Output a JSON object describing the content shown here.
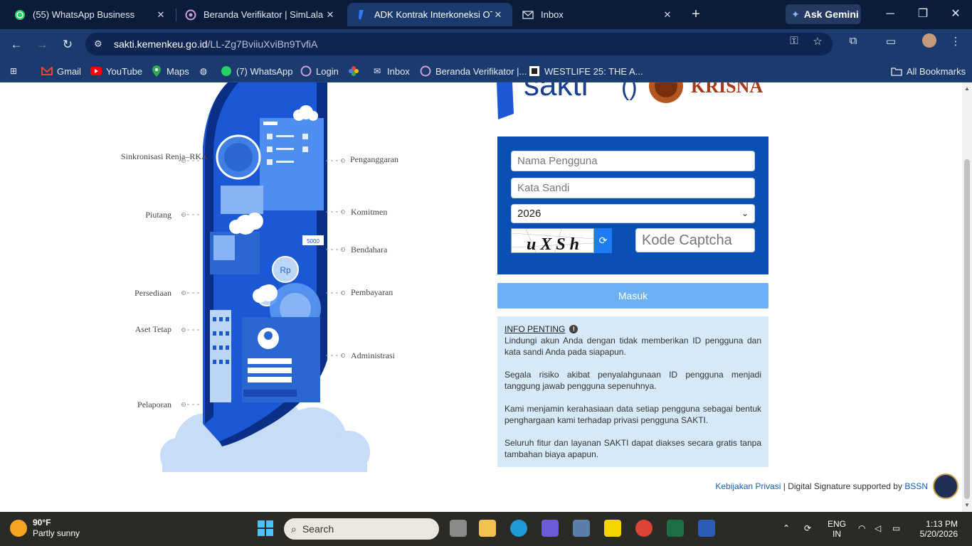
{
  "browser": {
    "tabs": [
      {
        "title": "(55) WhatsApp Business",
        "icon": "whatsapp-icon"
      },
      {
        "title": "Beranda Verifikator | SimLala",
        "icon": "simlala-icon"
      },
      {
        "title": "ADK Kontrak Interkoneksi OTP I",
        "icon": "sakti-icon"
      },
      {
        "title": "Inbox",
        "icon": "mail-icon"
      }
    ],
    "ask_gemini": "Ask Gemini",
    "url_host": "sakti.kemenkeu.go.id",
    "url_path": "/LL-Zg7BviiuXviBn9TvfiA",
    "bookmarks": [
      "Gmail",
      "YouTube",
      "Maps",
      "(7) WhatsApp",
      "Login",
      "Inbox",
      "Beranda Verifikator |...",
      "WESTLIFE 25: THE A..."
    ],
    "all_bookmarks": "All Bookmarks"
  },
  "illustration": {
    "left_labels": [
      "Sinkronisasi Renja–RKA",
      "Piutang",
      "Persediaan",
      "Aset Tetap",
      "Pelaporan"
    ],
    "right_labels": [
      "Penganggaran",
      "Komitmen",
      "Bendahara",
      "Pembayaran",
      "Administrasi"
    ]
  },
  "login": {
    "username_placeholder": "Nama Pengguna",
    "password_placeholder": "Kata Sandi",
    "year_value": "2026",
    "captcha_text": "u X S h",
    "captcha_placeholder": "Kode Captcha",
    "submit_label": "Masuk"
  },
  "info": {
    "title": "INFO PENTING",
    "paragraphs": [
      "Lindungi akun Anda dengan tidak memberikan ID pengguna dan kata sandi Anda pada siapapun.",
      "Segala risiko akibat penyalahgunaan ID pengguna menjadi tanggung jawab pengguna sepenuhnya.",
      "Kami menjamin kerahasiaan data setiap pengguna sebagai bentuk penghargaan kami terhadap privasi pengguna SAKTI.",
      "Seluruh fitur dan layanan SAKTI dapat diakses secara gratis tanpa tambahan biaya apapun."
    ]
  },
  "footer": {
    "privacy_link": "Kebijakan Privasi",
    "separator": "|",
    "signature_text": "Digital Signature supported by",
    "bssn_link": "BSSN"
  },
  "logos": {
    "sakti": "sakti",
    "krisna": "KRISNA"
  },
  "taskbar": {
    "temperature": "90°F",
    "weather": "Partly sunny",
    "search_label": "Search",
    "lang": "ENG",
    "region": "IN",
    "time": "1:13 PM",
    "date": "5/20/2026"
  },
  "colors": {
    "login_bg": "#0a4fb4",
    "submit_bg": "#6cb1f5",
    "info_bg": "#d6e9f8",
    "browser_chrome": "#1b3a6e"
  }
}
